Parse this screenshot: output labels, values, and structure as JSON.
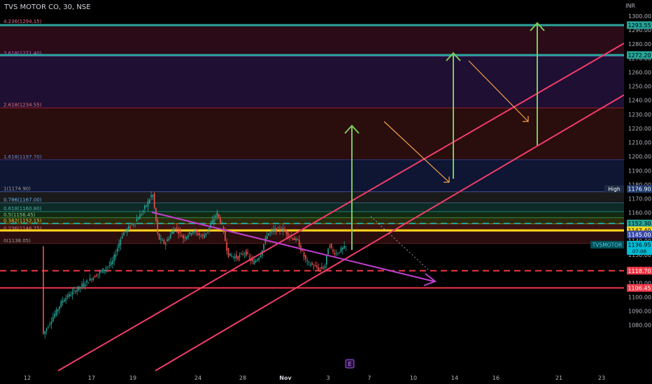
{
  "header": {
    "title": "TVS MOTOR CO, 30, NSE",
    "currency": "INR"
  },
  "chart_data": {
    "type": "candlestick",
    "symbol": "TVSMOTOR",
    "timeframe": "30",
    "exchange": "NSE",
    "y_axis_ticks": [
      1080,
      1090,
      1100,
      1110,
      1120,
      1130,
      1140,
      1150,
      1160,
      1170,
      1180,
      1190,
      1200,
      1210,
      1220,
      1230,
      1240,
      1250,
      1260,
      1270,
      1280,
      1290,
      1300
    ],
    "ylim": [
      1076,
      1305
    ],
    "x_axis_ticks": [
      "12",
      "17",
      "19",
      "24",
      "28",
      "Nov",
      "3",
      "7",
      "10",
      "14",
      "16",
      "21",
      "23"
    ],
    "fib_levels": [
      {
        "label": "0(1138.05)",
        "value": 1138.05,
        "fill": "#2a0d0d",
        "line": "#7a2a2a",
        "text": "#9e9e9e"
      },
      {
        "label": "0.236(1146.75)",
        "value": 1146.75,
        "fill": "#3a1414",
        "line": "#e05a3a",
        "text": "#e57373"
      },
      {
        "label": "0.382(1152.15)",
        "value": 1152.15,
        "fill": "#2b2b0d",
        "line": "#c8b400",
        "text": "#e0c84a"
      },
      {
        "label": "0.5(1156.45)",
        "value": 1156.45,
        "fill": "#122a12",
        "line": "#4caf50",
        "text": "#81c784"
      },
      {
        "label": "0.618(1160.80)",
        "value": 1160.8,
        "fill": "#0d2a26",
        "line": "#26a69a",
        "text": "#4db6ac"
      },
      {
        "label": "0.786(1167.00)",
        "value": 1167.0,
        "fill": "#1a1a1a",
        "line": "#4a7fa8",
        "text": "#64b5f6"
      },
      {
        "label": "1(1174.90)",
        "value": 1174.9,
        "fill": "#0e1633",
        "line": "#5c6bc0",
        "text": "#9e9e9e"
      },
      {
        "label": "1.618(1197.70)",
        "value": 1197.7,
        "fill": "#2a0d0d",
        "line": "#3949ab",
        "text": "#5c8ee0"
      },
      {
        "label": "2.618(1234.55)",
        "value": 1234.55,
        "fill": "#1f0f33",
        "line": "#c62828",
        "text": "#e57373"
      },
      {
        "label": "3.618(1271.40)",
        "value": 1271.4,
        "fill": "#2b0b18",
        "line": "#8e24aa",
        "text": "#ba68c8"
      },
      {
        "label": "4.236(1294.15)",
        "value": 1294.15,
        "fill": null,
        "line": "#e91e63",
        "text": "#f06292"
      }
    ],
    "horizontal_lines": [
      {
        "value": 1293.55,
        "color": "#26a69a",
        "style": "solid",
        "width": 3
      },
      {
        "value": 1272.2,
        "color": "#26a69a",
        "style": "solid",
        "width": 3
      },
      {
        "value": 1152.3,
        "color": "#26a69a",
        "style": "dashed",
        "width": 2
      },
      {
        "value": 1147.4,
        "color": "#f9d71c",
        "style": "solid",
        "width": 3
      },
      {
        "value": 1118.7,
        "color": "#f23645",
        "style": "dashed",
        "width": 2
      },
      {
        "value": 1106.45,
        "color": "#f23645",
        "style": "solid",
        "width": 2
      }
    ],
    "price_labels": [
      {
        "text": "1293.55",
        "value": 1293.55,
        "bg": "#26a69a",
        "fg": "#000000"
      },
      {
        "text": "1272.20",
        "value": 1272.2,
        "bg": "#26a69a",
        "fg": "#000000"
      },
      {
        "text": "1176.90",
        "value": 1176.9,
        "bg": "#1e3a6e",
        "fg": "#ffffff",
        "tag": "High"
      },
      {
        "text": "1152.30",
        "value": 1152.3,
        "bg": "#26a69a",
        "fg": "#000000"
      },
      {
        "text": "1147.40",
        "value": 1147.4,
        "bg": "#f9d71c",
        "fg": "#000000"
      },
      {
        "text": "1145.00",
        "value": 1144.5,
        "bg": "#3949ab",
        "fg": "#ffffff"
      },
      {
        "text": "1136.95",
        "value": 1137.2,
        "bg": "#00bcd4",
        "fg": "#000000",
        "tag": "TVSMOTOR",
        "sub": "07:08"
      },
      {
        "text": "1118.70",
        "value": 1118.7,
        "bg": "#f23645",
        "fg": "#ffffff"
      },
      {
        "text": "1106.45",
        "value": 1106.45,
        "bg": "#f23645",
        "fg": "#ffffff"
      }
    ],
    "marker": "E",
    "last_price": 1136.95,
    "countdown": "07:08"
  }
}
